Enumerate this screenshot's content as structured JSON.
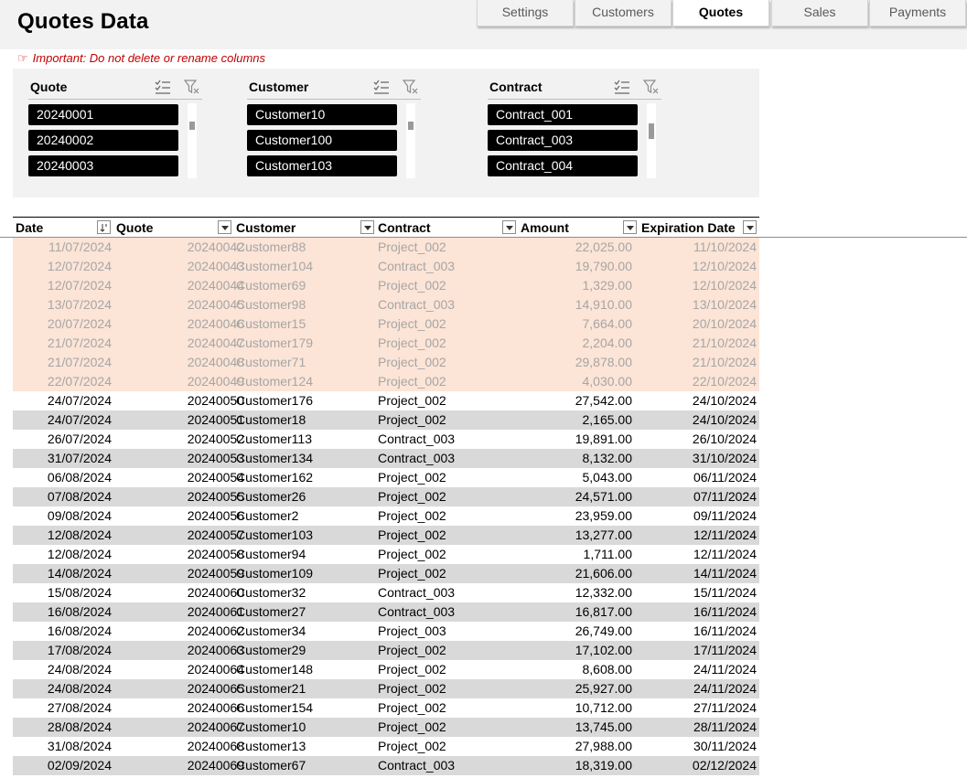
{
  "title": "Quotes Data",
  "notice": "Important: Do not delete or rename columns",
  "tabs": [
    {
      "label": "Settings",
      "active": false
    },
    {
      "label": "Customers",
      "active": false
    },
    {
      "label": "Quotes",
      "active": true
    },
    {
      "label": "Sales",
      "active": false
    },
    {
      "label": "Payments",
      "active": false
    }
  ],
  "slicers": [
    {
      "name": "Quote",
      "items": [
        "20240001",
        "20240002",
        "20240003"
      ],
      "scroll_position": 0.0
    },
    {
      "name": "Customer",
      "items": [
        "Customer10",
        "Customer100",
        "Customer103"
      ],
      "scroll_position": 0.0
    },
    {
      "name": "Contract",
      "items": [
        "Contract_001",
        "Contract_003",
        "Contract_004"
      ],
      "scroll_position": 0.0
    }
  ],
  "table": {
    "columns": [
      "Date",
      "Quote",
      "Customer",
      "Contract",
      "Amount",
      "Expiration Date"
    ],
    "rows": [
      {
        "date": "11/07/2024",
        "quote": "20240042",
        "customer": "Customer88",
        "contract": "Project_002",
        "amount": "22,025.00",
        "exp": "11/10/2024",
        "expired": true
      },
      {
        "date": "12/07/2024",
        "quote": "20240043",
        "customer": "Customer104",
        "contract": "Contract_003",
        "amount": "19,790.00",
        "exp": "12/10/2024",
        "expired": true
      },
      {
        "date": "12/07/2024",
        "quote": "20240044",
        "customer": "Customer69",
        "contract": "Project_002",
        "amount": "1,329.00",
        "exp": "12/10/2024",
        "expired": true
      },
      {
        "date": "13/07/2024",
        "quote": "20240045",
        "customer": "Customer98",
        "contract": "Contract_003",
        "amount": "14,910.00",
        "exp": "13/10/2024",
        "expired": true
      },
      {
        "date": "20/07/2024",
        "quote": "20240046",
        "customer": "Customer15",
        "contract": "Project_002",
        "amount": "7,664.00",
        "exp": "20/10/2024",
        "expired": true
      },
      {
        "date": "21/07/2024",
        "quote": "20240047",
        "customer": "Customer179",
        "contract": "Project_002",
        "amount": "2,204.00",
        "exp": "21/10/2024",
        "expired": true
      },
      {
        "date": "21/07/2024",
        "quote": "20240048",
        "customer": "Customer71",
        "contract": "Project_002",
        "amount": "29,878.00",
        "exp": "21/10/2024",
        "expired": true
      },
      {
        "date": "22/07/2024",
        "quote": "20240049",
        "customer": "Customer124",
        "contract": "Project_002",
        "amount": "4,030.00",
        "exp": "22/10/2024",
        "expired": true
      },
      {
        "date": "24/07/2024",
        "quote": "20240050",
        "customer": "Customer176",
        "contract": "Project_002",
        "amount": "27,542.00",
        "exp": "24/10/2024",
        "expired": false
      },
      {
        "date": "24/07/2024",
        "quote": "20240051",
        "customer": "Customer18",
        "contract": "Project_002",
        "amount": "2,165.00",
        "exp": "24/10/2024",
        "expired": false
      },
      {
        "date": "26/07/2024",
        "quote": "20240052",
        "customer": "Customer113",
        "contract": "Contract_003",
        "amount": "19,891.00",
        "exp": "26/10/2024",
        "expired": false
      },
      {
        "date": "31/07/2024",
        "quote": "20240053",
        "customer": "Customer134",
        "contract": "Contract_003",
        "amount": "8,132.00",
        "exp": "31/10/2024",
        "expired": false
      },
      {
        "date": "06/08/2024",
        "quote": "20240054",
        "customer": "Customer162",
        "contract": "Project_002",
        "amount": "5,043.00",
        "exp": "06/11/2024",
        "expired": false
      },
      {
        "date": "07/08/2024",
        "quote": "20240055",
        "customer": "Customer26",
        "contract": "Project_002",
        "amount": "24,571.00",
        "exp": "07/11/2024",
        "expired": false
      },
      {
        "date": "09/08/2024",
        "quote": "20240056",
        "customer": "Customer2",
        "contract": "Project_002",
        "amount": "23,959.00",
        "exp": "09/11/2024",
        "expired": false
      },
      {
        "date": "12/08/2024",
        "quote": "20240057",
        "customer": "Customer103",
        "contract": "Project_002",
        "amount": "13,277.00",
        "exp": "12/11/2024",
        "expired": false
      },
      {
        "date": "12/08/2024",
        "quote": "20240058",
        "customer": "Customer94",
        "contract": "Project_002",
        "amount": "1,711.00",
        "exp": "12/11/2024",
        "expired": false
      },
      {
        "date": "14/08/2024",
        "quote": "20240059",
        "customer": "Customer109",
        "contract": "Project_002",
        "amount": "21,606.00",
        "exp": "14/11/2024",
        "expired": false
      },
      {
        "date": "15/08/2024",
        "quote": "20240060",
        "customer": "Customer32",
        "contract": "Contract_003",
        "amount": "12,332.00",
        "exp": "15/11/2024",
        "expired": false
      },
      {
        "date": "16/08/2024",
        "quote": "20240061",
        "customer": "Customer27",
        "contract": "Contract_003",
        "amount": "16,817.00",
        "exp": "16/11/2024",
        "expired": false
      },
      {
        "date": "16/08/2024",
        "quote": "20240062",
        "customer": "Customer34",
        "contract": "Project_003",
        "amount": "26,749.00",
        "exp": "16/11/2024",
        "expired": false
      },
      {
        "date": "17/08/2024",
        "quote": "20240063",
        "customer": "Customer29",
        "contract": "Project_002",
        "amount": "17,102.00",
        "exp": "17/11/2024",
        "expired": false
      },
      {
        "date": "24/08/2024",
        "quote": "20240064",
        "customer": "Customer148",
        "contract": "Project_002",
        "amount": "8,608.00",
        "exp": "24/11/2024",
        "expired": false
      },
      {
        "date": "24/08/2024",
        "quote": "20240065",
        "customer": "Customer21",
        "contract": "Project_002",
        "amount": "25,927.00",
        "exp": "24/11/2024",
        "expired": false
      },
      {
        "date": "27/08/2024",
        "quote": "20240066",
        "customer": "Customer154",
        "contract": "Project_002",
        "amount": "10,712.00",
        "exp": "27/11/2024",
        "expired": false
      },
      {
        "date": "28/08/2024",
        "quote": "20240067",
        "customer": "Customer10",
        "contract": "Project_002",
        "amount": "13,745.00",
        "exp": "28/11/2024",
        "expired": false
      },
      {
        "date": "31/08/2024",
        "quote": "20240068",
        "customer": "Customer13",
        "contract": "Project_002",
        "amount": "27,988.00",
        "exp": "30/11/2024",
        "expired": false
      },
      {
        "date": "02/09/2024",
        "quote": "20240069",
        "customer": "Customer67",
        "contract": "Contract_003",
        "amount": "18,319.00",
        "exp": "02/12/2024",
        "expired": false
      }
    ]
  },
  "colors": {
    "accent_notice": "#c00000",
    "expired_row_bg": "#fce4d6",
    "band_row_bg": "#d9d9d9",
    "slicer_item_bg": "#000000"
  },
  "icons": {
    "multi_select": "multi-select-icon",
    "clear_filter": "clear-filter-icon",
    "dropdown": "dropdown-arrow-icon",
    "sort": "sort-ascending-icon"
  }
}
